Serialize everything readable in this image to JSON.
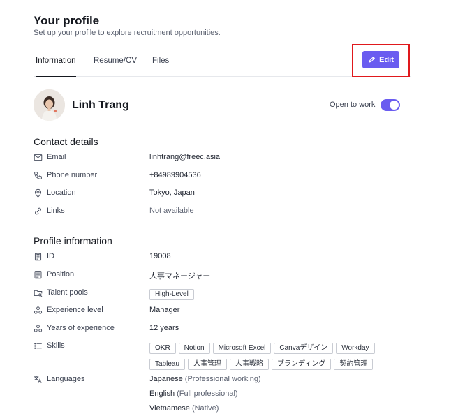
{
  "header": {
    "title": "Your profile",
    "subtitle": "Set up your profile to explore recruitment opportunities."
  },
  "tabs": [
    {
      "label": "Information",
      "active": true
    },
    {
      "label": "Resume/CV",
      "active": false
    },
    {
      "label": "Files",
      "active": false
    }
  ],
  "edit_button": {
    "label": "Edit",
    "icon": "pencil-icon",
    "color": "#6a5cf0"
  },
  "profile": {
    "name": "Linh Trang",
    "open_to_work_label": "Open to work",
    "open_to_work": true
  },
  "contact": {
    "title": "Contact details",
    "rows": [
      {
        "icon": "mail-icon",
        "label": "Email",
        "value": "linhtrang@freec.asia"
      },
      {
        "icon": "phone-icon",
        "label": "Phone number",
        "value": "+84989904536"
      },
      {
        "icon": "location-pin-icon",
        "label": "Location",
        "value": "Tokyo, Japan"
      },
      {
        "icon": "link-icon",
        "label": "Links",
        "value": "Not available"
      }
    ]
  },
  "profile_info": {
    "title": "Profile information",
    "id_label": "ID",
    "id_value": "19008",
    "position_label": "Position",
    "position_value": "人事マネージャー",
    "talent_pools_label": "Talent pools",
    "talent_pools": [
      "High-Level"
    ],
    "experience_level_label": "Experience level",
    "experience_level_value": "Manager",
    "years_label": "Years of experience",
    "years_value": "12 years",
    "skills_label": "Skills",
    "skills_row1": [
      "OKR",
      "Notion",
      "Microsoft Excel",
      "Canvaデザイン",
      "Workday"
    ],
    "skills_row2": [
      "Tableau",
      "人事管理",
      "人事戦略",
      "ブランディング",
      "契約管理"
    ],
    "languages_label": "Languages",
    "languages": [
      {
        "name": "Japanese",
        "level": "(Professional working)"
      },
      {
        "name": "English",
        "level": "(Full professional)"
      },
      {
        "name": "Vietnamese",
        "level": "(Native)"
      }
    ]
  },
  "colors": {
    "accent": "#6a5cf0",
    "highlight": "#e0191d"
  }
}
